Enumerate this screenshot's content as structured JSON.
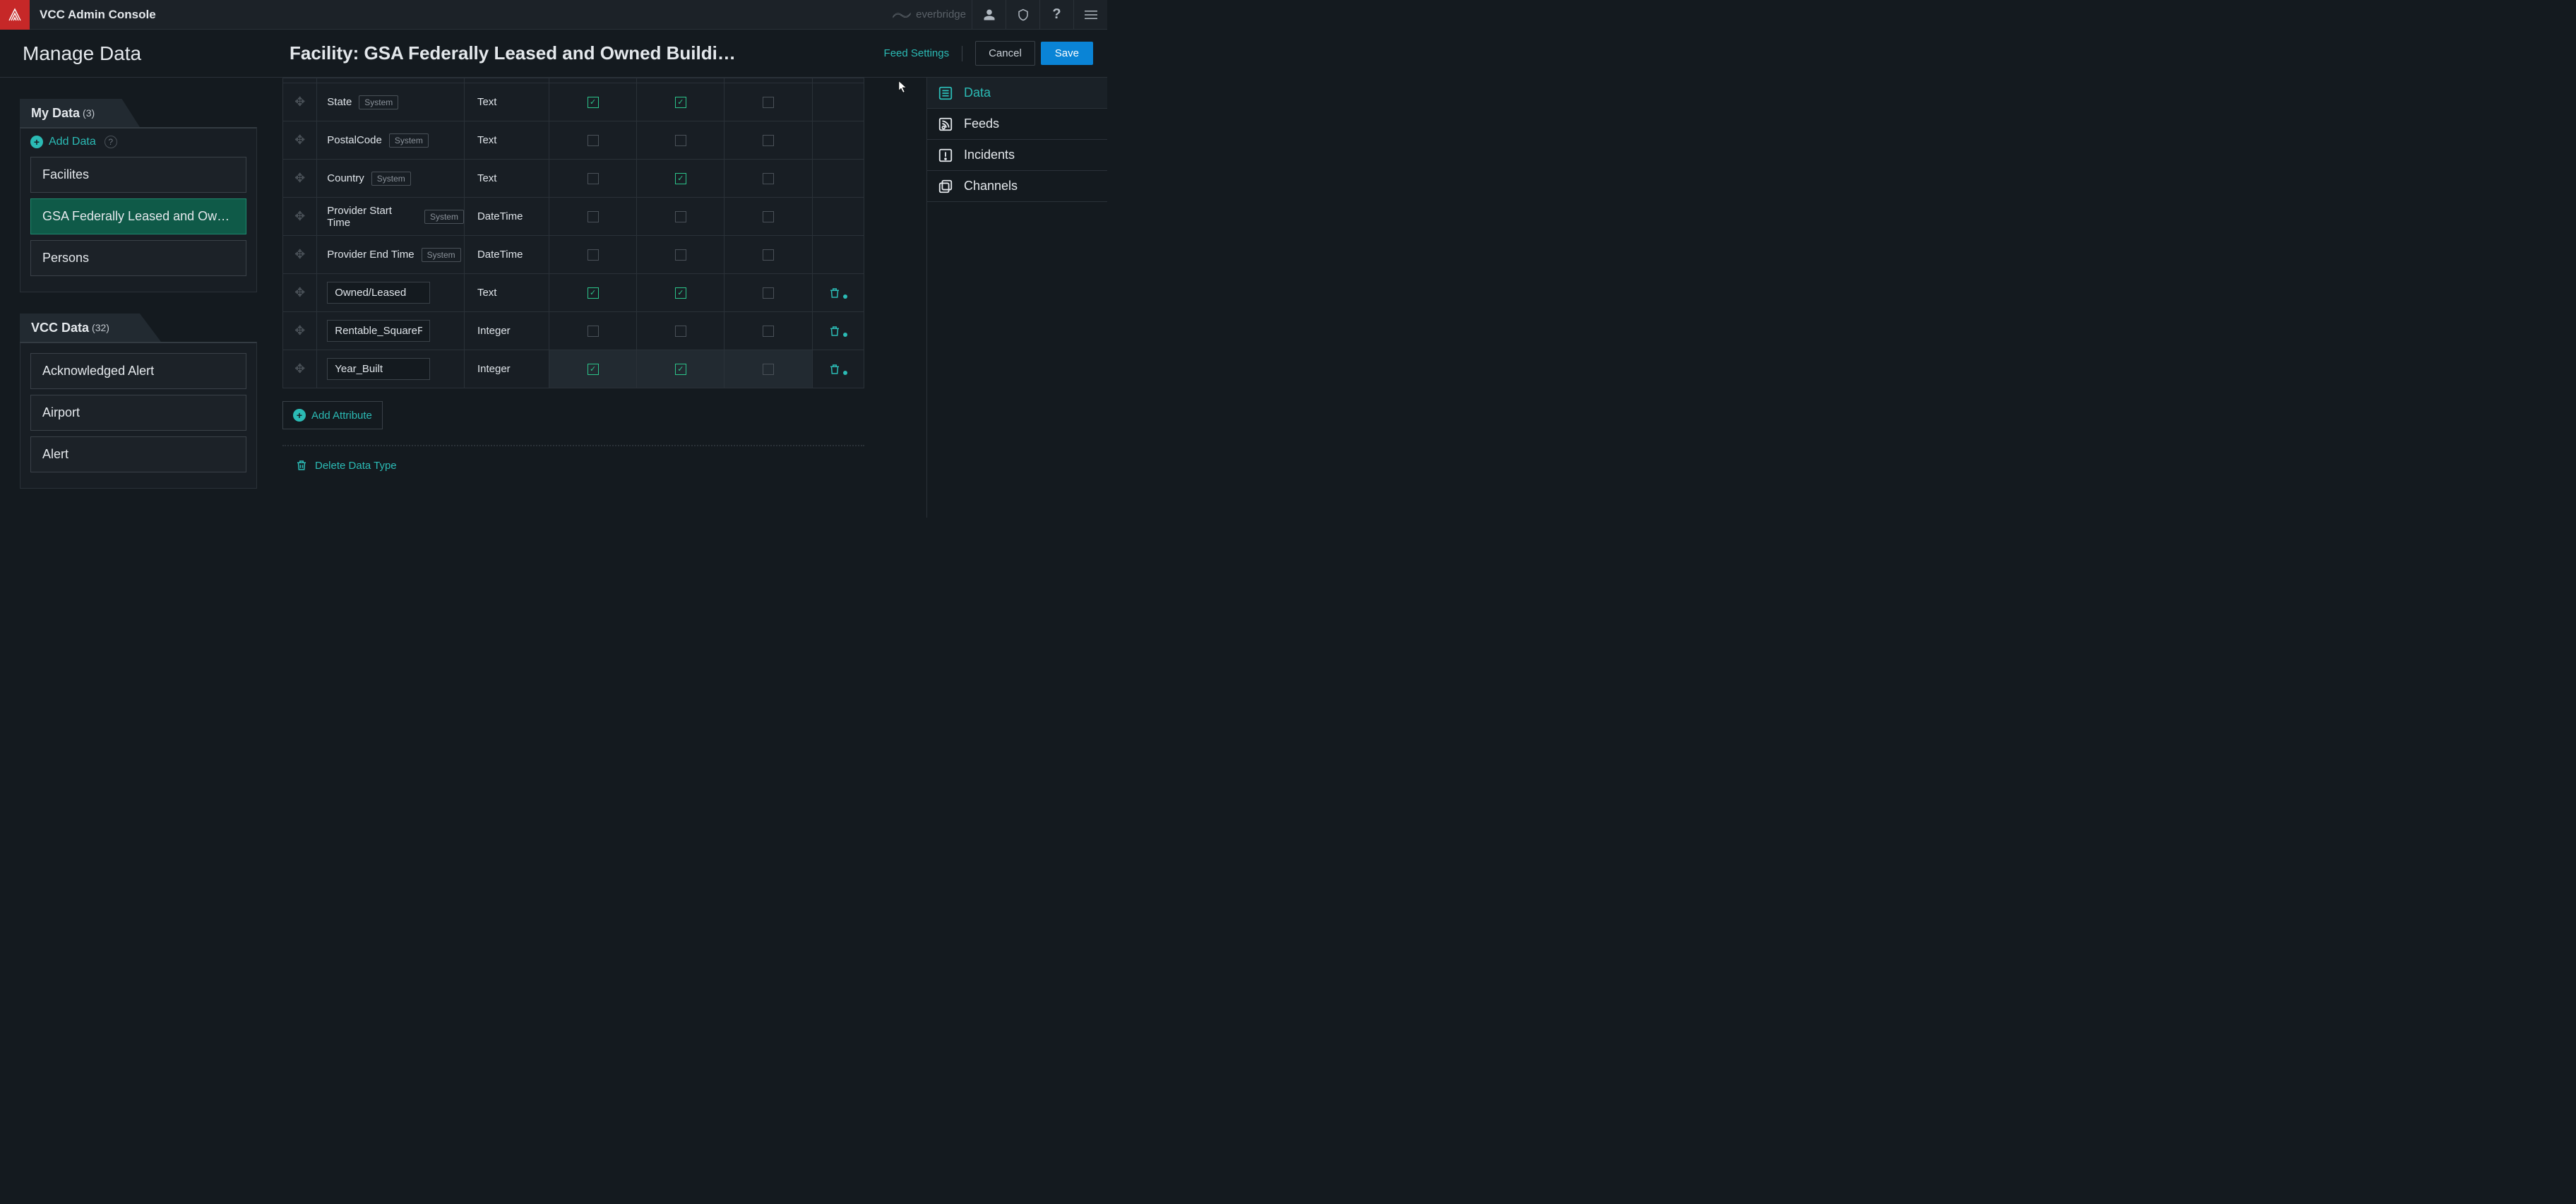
{
  "topbar": {
    "app_title": "VCC Admin Console",
    "brand": "everbridge"
  },
  "header": {
    "left_title": "Manage Data",
    "page_title": "Facility: GSA Federally Leased and Owned Buildi…",
    "feed_settings": "Feed Settings",
    "cancel": "Cancel",
    "save": "Save"
  },
  "left": {
    "mydata_label": "My Data",
    "mydata_count": "(3)",
    "add_data": "Add Data",
    "mydata_items": [
      {
        "label": "Facilites",
        "active": false
      },
      {
        "label": "GSA Federally Leased and Ow…",
        "active": true
      },
      {
        "label": "Persons",
        "active": false
      }
    ],
    "vccdata_label": "VCC Data",
    "vccdata_count": "(32)",
    "vccdata_items": [
      {
        "label": "Acknowledged Alert"
      },
      {
        "label": "Airport"
      },
      {
        "label": "Alert"
      }
    ]
  },
  "table": {
    "system_badge": "System",
    "rows": [
      {
        "name": "State",
        "system": true,
        "type": "Text",
        "c1": true,
        "c2": true,
        "c3": false,
        "editable": false,
        "deletable": false,
        "highlight": false
      },
      {
        "name": "PostalCode",
        "system": true,
        "type": "Text",
        "c1": false,
        "c2": false,
        "c3": false,
        "editable": false,
        "deletable": false,
        "highlight": false
      },
      {
        "name": "Country",
        "system": true,
        "type": "Text",
        "c1": false,
        "c2": true,
        "c3": false,
        "editable": false,
        "deletable": false,
        "highlight": false
      },
      {
        "name": "Provider Start Time",
        "system": true,
        "type": "DateTime",
        "c1": false,
        "c2": false,
        "c3": false,
        "editable": false,
        "deletable": false,
        "highlight": false
      },
      {
        "name": "Provider End Time",
        "system": true,
        "type": "DateTime",
        "c1": false,
        "c2": false,
        "c3": false,
        "editable": false,
        "deletable": false,
        "highlight": false
      },
      {
        "name": "Owned/Leased",
        "system": false,
        "type": "Text",
        "c1": true,
        "c2": true,
        "c3": false,
        "editable": true,
        "deletable": true,
        "highlight": false
      },
      {
        "name": "Rentable_SquareFeet",
        "system": false,
        "type": "Integer",
        "c1": false,
        "c2": false,
        "c3": false,
        "editable": true,
        "deletable": true,
        "highlight": false
      },
      {
        "name": "Year_Built",
        "system": false,
        "type": "Integer",
        "c1": true,
        "c2": true,
        "c3": false,
        "editable": true,
        "deletable": true,
        "highlight": true
      }
    ],
    "add_attribute": "Add Attribute",
    "delete_type": "Delete Data Type"
  },
  "right": {
    "items": [
      {
        "label": "Data",
        "active": true,
        "icon": "list"
      },
      {
        "label": "Feeds",
        "active": false,
        "icon": "rss"
      },
      {
        "label": "Incidents",
        "active": false,
        "icon": "alert"
      },
      {
        "label": "Channels",
        "active": false,
        "icon": "channels"
      }
    ]
  }
}
